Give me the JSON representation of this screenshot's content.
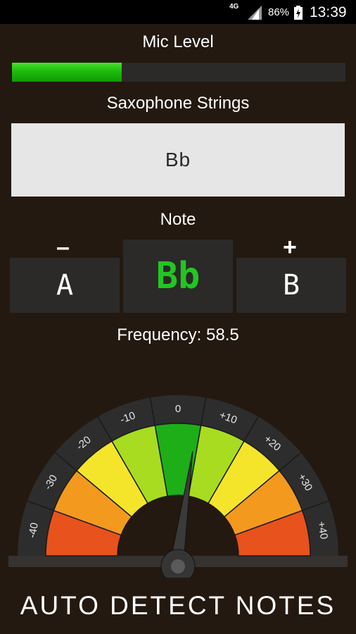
{
  "status_bar": {
    "network": "4G",
    "battery_percent": "86%",
    "time": "13:39"
  },
  "mic": {
    "title": "Mic Level",
    "level": 0.33
  },
  "strings": {
    "title": "Saxophone Strings",
    "selected": "Bb"
  },
  "note": {
    "title": "Note",
    "minus_label": "–",
    "plus_label": "+",
    "previous": "A",
    "current": "Bb",
    "next": "B",
    "current_color": "#22c622"
  },
  "frequency": {
    "text": "Frequency: 58.5"
  },
  "gauge": {
    "labels": [
      "-40",
      "-30",
      "-20",
      "-10",
      "0",
      "+10",
      "+20",
      "+30",
      "+40"
    ],
    "zone_colors": [
      "#e8521c",
      "#f39a1e",
      "#f4e52a",
      "#a8dc20",
      "#1eae18",
      "#a8dc20",
      "#f4e52a",
      "#f39a1e",
      "#e8521c"
    ],
    "needle_value": 4
  },
  "auto_detect": {
    "label": "AUTO DETECT NOTES"
  }
}
